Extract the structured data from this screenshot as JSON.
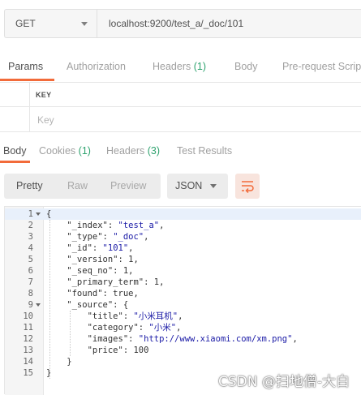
{
  "request": {
    "method": "GET",
    "url": "localhost:9200/test_a/_doc/101"
  },
  "request_tabs": [
    {
      "label": "Params",
      "count": ""
    },
    {
      "label": "Authorization",
      "count": ""
    },
    {
      "label": "Headers",
      "count": "(1)"
    },
    {
      "label": "Body",
      "count": ""
    },
    {
      "label": "Pre-request Script",
      "count": ""
    }
  ],
  "params": {
    "key_header": "KEY",
    "key_placeholder": "Key"
  },
  "response_tabs": [
    {
      "label": "Body",
      "count": ""
    },
    {
      "label": "Cookies",
      "count": "(1)"
    },
    {
      "label": "Headers",
      "count": "(3)"
    },
    {
      "label": "Test Results",
      "count": ""
    }
  ],
  "view_modes": [
    "Pretty",
    "Raw",
    "Preview"
  ],
  "format": "JSON",
  "code_lines": [
    {
      "n": "1",
      "text": "{"
    },
    {
      "n": "2",
      "text": "    \"_index\": \"test_a\","
    },
    {
      "n": "3",
      "text": "    \"_type\": \"_doc\","
    },
    {
      "n": "4",
      "text": "    \"_id\": \"101\","
    },
    {
      "n": "5",
      "text": "    \"_version\": 1,"
    },
    {
      "n": "6",
      "text": "    \"_seq_no\": 1,"
    },
    {
      "n": "7",
      "text": "    \"_primary_term\": 1,"
    },
    {
      "n": "8",
      "text": "    \"found\": true,"
    },
    {
      "n": "9",
      "text": "    \"_source\": {"
    },
    {
      "n": "10",
      "text": "        \"title\": \"小米耳机\","
    },
    {
      "n": "11",
      "text": "        \"category\": \"小米\","
    },
    {
      "n": "12",
      "text": "        \"images\": \"http://www.xiaomi.com/xm.png\","
    },
    {
      "n": "13",
      "text": "        \"price\": 100"
    },
    {
      "n": "14",
      "text": "    }"
    },
    {
      "n": "15",
      "text": "}"
    }
  ],
  "watermark": "CSDN @扫地僧-大白",
  "colors": {
    "accent": "#f26b3a",
    "count_green": "#2fa36f",
    "string_blue": "#1a1aa6"
  }
}
